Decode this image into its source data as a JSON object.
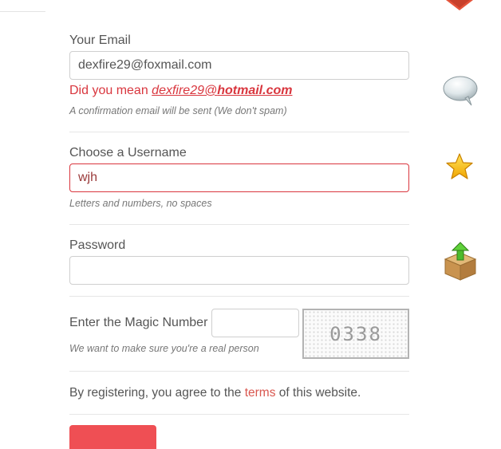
{
  "email": {
    "label": "Your Email",
    "value": "dexfire29@foxmail.com",
    "suggestion_prefix": "Did you mean ",
    "suggestion_user": "dexfire29@",
    "suggestion_domain": "hotmail.com",
    "hint": "A confirmation email will be sent (We don't spam)"
  },
  "username": {
    "label": "Choose a Username",
    "value": "wjh",
    "hint": "Letters and numbers, no spaces"
  },
  "password": {
    "label": "Password",
    "value": ""
  },
  "magic": {
    "label": "Enter the Magic Number",
    "value": "",
    "captcha_text": "0338",
    "hint": "We want to make sure you're a real person"
  },
  "terms": {
    "before": "By registering, you agree to the ",
    "link": "terms",
    "after": " of this website."
  },
  "icons": [
    "heart-icon",
    "speech-bubble-icon",
    "star-icon",
    "upload-box-icon"
  ],
  "colors": {
    "accent": "#ef4f54",
    "error": "#d9363e"
  }
}
